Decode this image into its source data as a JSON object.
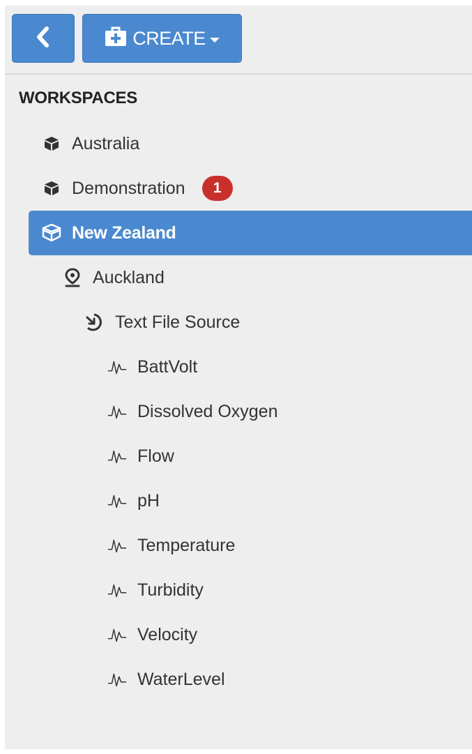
{
  "toolbar": {
    "back_icon": "chevron-left-icon",
    "create_label": "CREATE",
    "create_icon": "medkit-icon"
  },
  "workspaces": {
    "title": "WORKSPACES",
    "items": [
      {
        "label": "Australia",
        "icon": "cube-icon"
      },
      {
        "label": "Demonstration",
        "icon": "cube-icon",
        "badge": "1"
      },
      {
        "label": "New Zealand",
        "icon": "cubes-icon",
        "selected": true
      },
      {
        "label": "Auckland",
        "icon": "map-marker-icon"
      },
      {
        "label": "Text File Source",
        "icon": "import-icon"
      },
      {
        "label": "BattVolt",
        "icon": "pulse-icon"
      },
      {
        "label": "Dissolved Oxygen",
        "icon": "pulse-icon"
      },
      {
        "label": "Flow",
        "icon": "pulse-icon"
      },
      {
        "label": "pH",
        "icon": "pulse-icon"
      },
      {
        "label": "Temperature",
        "icon": "pulse-icon"
      },
      {
        "label": "Turbidity",
        "icon": "pulse-icon"
      },
      {
        "label": "Velocity",
        "icon": "pulse-icon"
      },
      {
        "label": "WaterLevel",
        "icon": "pulse-icon"
      }
    ]
  },
  "colors": {
    "primary": "#4a89d0",
    "badge": "#c9302c",
    "panel_bg": "#eeeeee"
  }
}
